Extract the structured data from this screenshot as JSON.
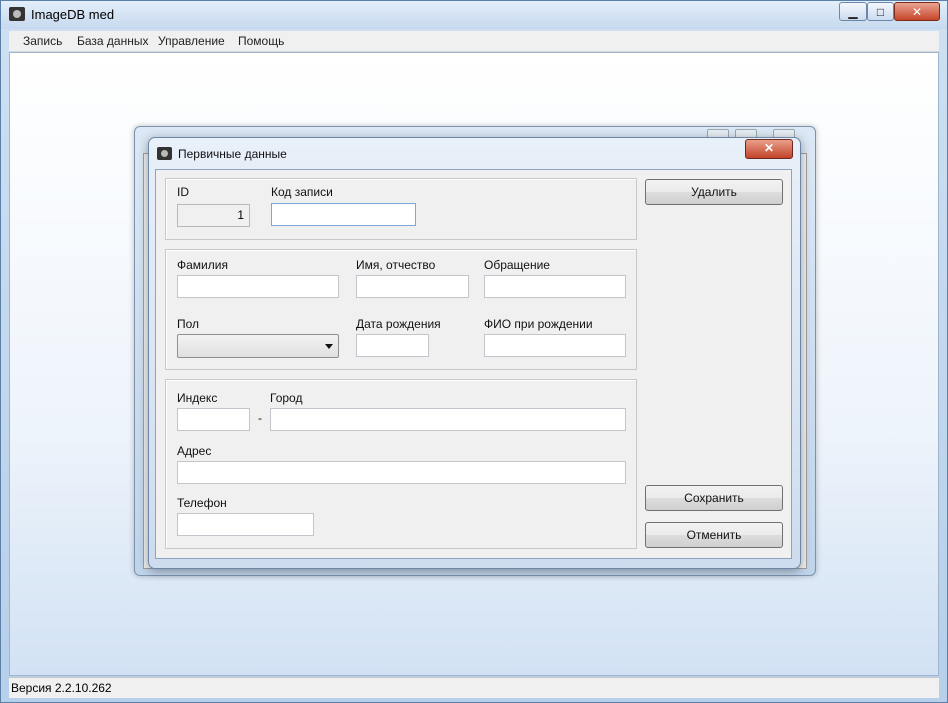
{
  "app": {
    "title": "ImageDB med",
    "window_buttons": {
      "minimize": "▁",
      "maximize": "□",
      "close": "✕"
    }
  },
  "menu": {
    "items": [
      "Запись",
      "База данных",
      "Управление",
      "Помощь"
    ]
  },
  "status": {
    "version": "Версия 2.2.10.262"
  },
  "dialog": {
    "title": "Первичные данные",
    "close": "✕",
    "record": {
      "id_label": "ID",
      "id_value": "1",
      "code_label": "Код записи",
      "code_value": ""
    },
    "person": {
      "surname_label": "Фамилия",
      "surname_value": "",
      "name_label": "Имя, отчество",
      "name_value": "",
      "salutation_label": "Обращение",
      "salutation_value": "",
      "sex_label": "Пол",
      "sex_value": "",
      "birthdate_label": "Дата рождения",
      "birthdate_value": "",
      "birthname_label": "ФИО при рождении",
      "birthname_value": ""
    },
    "address": {
      "index_label": "Индекс",
      "index_value": "",
      "dash": "-",
      "city_label": "Город",
      "city_value": "",
      "address_label": "Адрес",
      "address_value": "",
      "phone_label": "Телефон",
      "phone_value": ""
    },
    "buttons": {
      "delete": "Удалить",
      "save": "Сохранить",
      "cancel": "Отменить"
    }
  }
}
